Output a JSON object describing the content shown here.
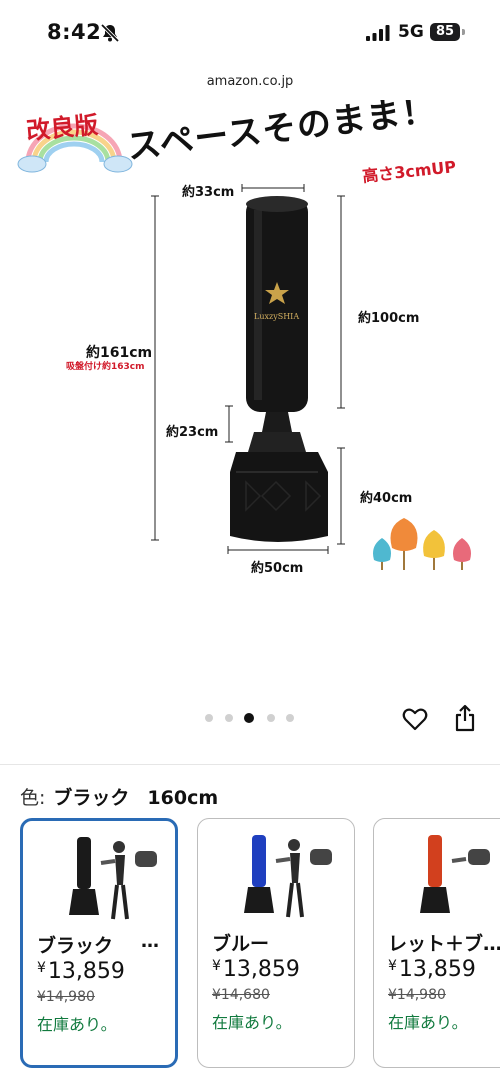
{
  "status_bar": {
    "time": "8:42",
    "network": "5G",
    "battery": "85",
    "icons": [
      "bell-slash-icon",
      "signal-icon",
      "battery-icon"
    ]
  },
  "browser": {
    "url": "amazon.co.jp"
  },
  "product_image": {
    "badge": "改良版",
    "headline": "スペースそのまま！",
    "height_up": "高さ3cmUP",
    "brand": "LuxzySHIA",
    "dims": {
      "top_width": "約33cm",
      "bag_height": "約100cm",
      "total_height": "約161cm",
      "total_height_suction": "吸盤付け約163cm",
      "neck_height": "約23cm",
      "base_height": "約40cm",
      "base_width": "約50cm"
    },
    "colors": {
      "bag": "#141414",
      "dimension_line": "#222222",
      "accent_red": "#d11a2a"
    }
  },
  "carousel": {
    "total": 5,
    "active_index": 2
  },
  "actions": {
    "favorite_icon": "heart-icon",
    "share_icon": "share-icon"
  },
  "color_selector": {
    "key": "色:",
    "selected_color": "ブラック",
    "selected_size": "160cm"
  },
  "variants": [
    {
      "name": "ブラック",
      "more": "…",
      "yen": "¥",
      "price": "13,859",
      "list_price": "¥14,980",
      "stock": "在庫あり。",
      "color": "#1a1a1a",
      "selected": true
    },
    {
      "name": "ブルー",
      "more": "",
      "yen": "¥",
      "price": "13,859",
      "list_price": "¥14,680",
      "stock": "在庫あり。",
      "color": "#1f3fbf",
      "selected": false
    },
    {
      "name": "レット＋ブ…",
      "more": "",
      "yen": "¥",
      "price": "13,859",
      "list_price": "¥14,980",
      "stock": "在庫あり。",
      "color": "#d2401e",
      "selected": false
    }
  ],
  "theme": {
    "accent": "#2a6bb5",
    "stock_green": "#117a3e"
  }
}
